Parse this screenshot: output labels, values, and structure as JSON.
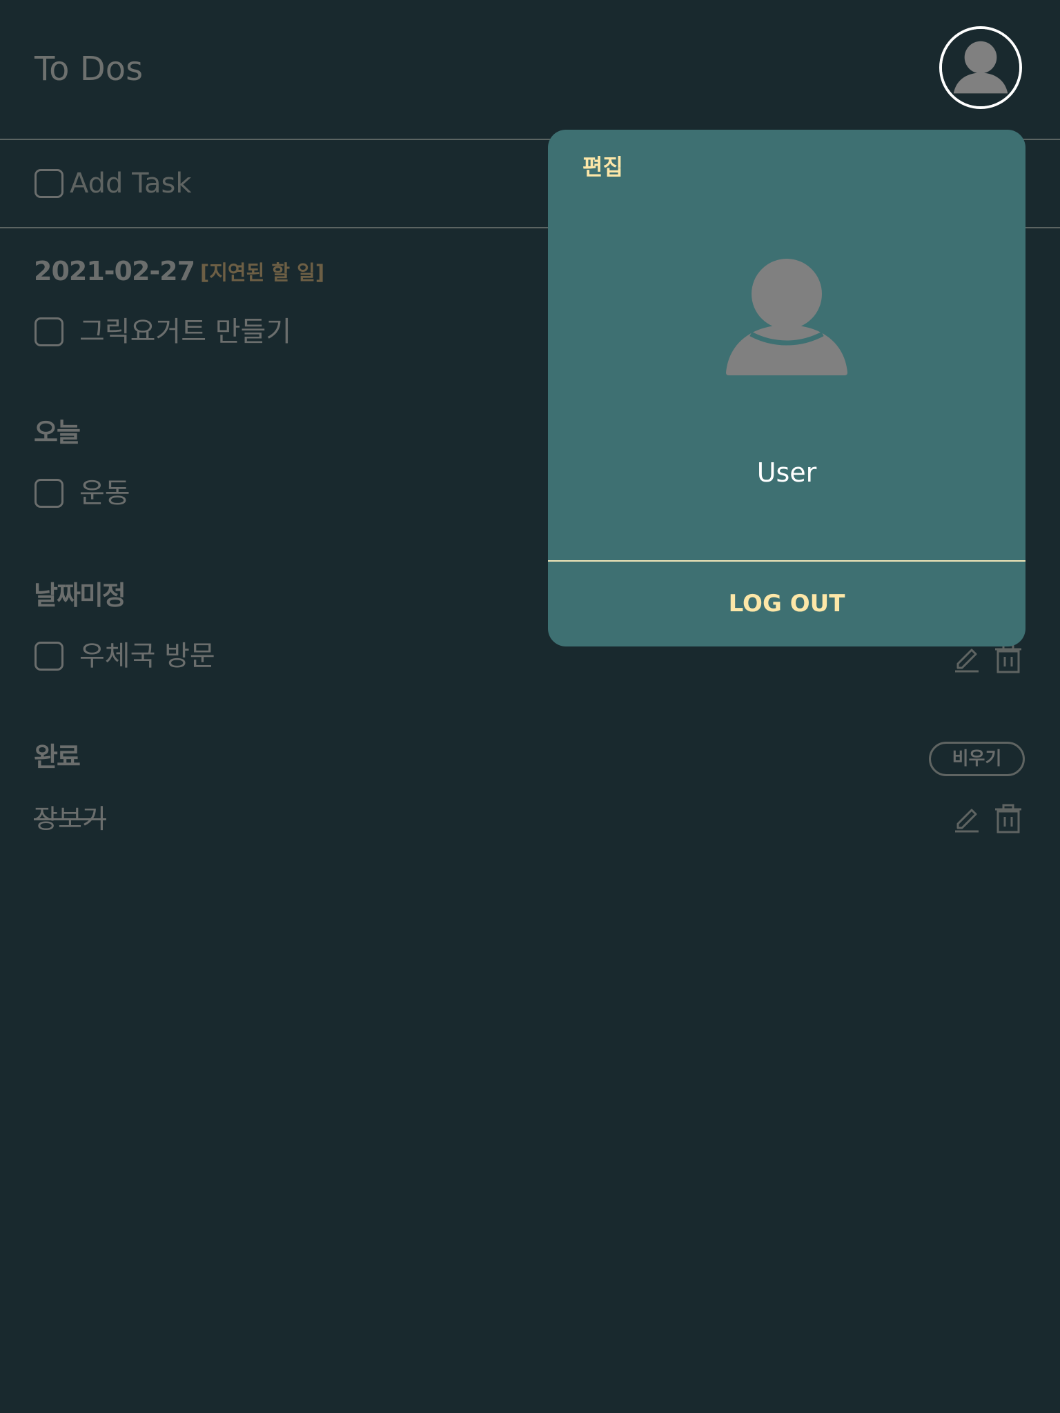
{
  "header": {
    "title": "To Dos",
    "avatar_icon": "user-avatar-icon"
  },
  "add_task": {
    "placeholder": "Add Task"
  },
  "sections": {
    "overdue": {
      "date": "2021-02-27",
      "tag": "[지연된 할 일]",
      "tasks": [
        {
          "text": "그릭요거트 만들기"
        }
      ]
    },
    "today": {
      "title": "오늘",
      "tasks": [
        {
          "text": "운동"
        }
      ]
    },
    "no_date": {
      "title": "날짜미정",
      "tasks": [
        {
          "text": "우체국 방문"
        }
      ]
    },
    "done": {
      "title": "완료",
      "clear_label": "비우기",
      "tasks": [
        {
          "text": "장보기"
        }
      ]
    }
  },
  "popup": {
    "edit_label": "편집",
    "username": "User",
    "logout_label": "LOG OUT"
  },
  "icons": {
    "edit": "pencil-icon",
    "delete": "trash-icon"
  },
  "colors": {
    "background": "#19292e",
    "popup_bg": "#3e7072",
    "accent": "#fde7a8",
    "muted_text": "#6b6e6d",
    "overdue_tag": "#6d5f45"
  }
}
